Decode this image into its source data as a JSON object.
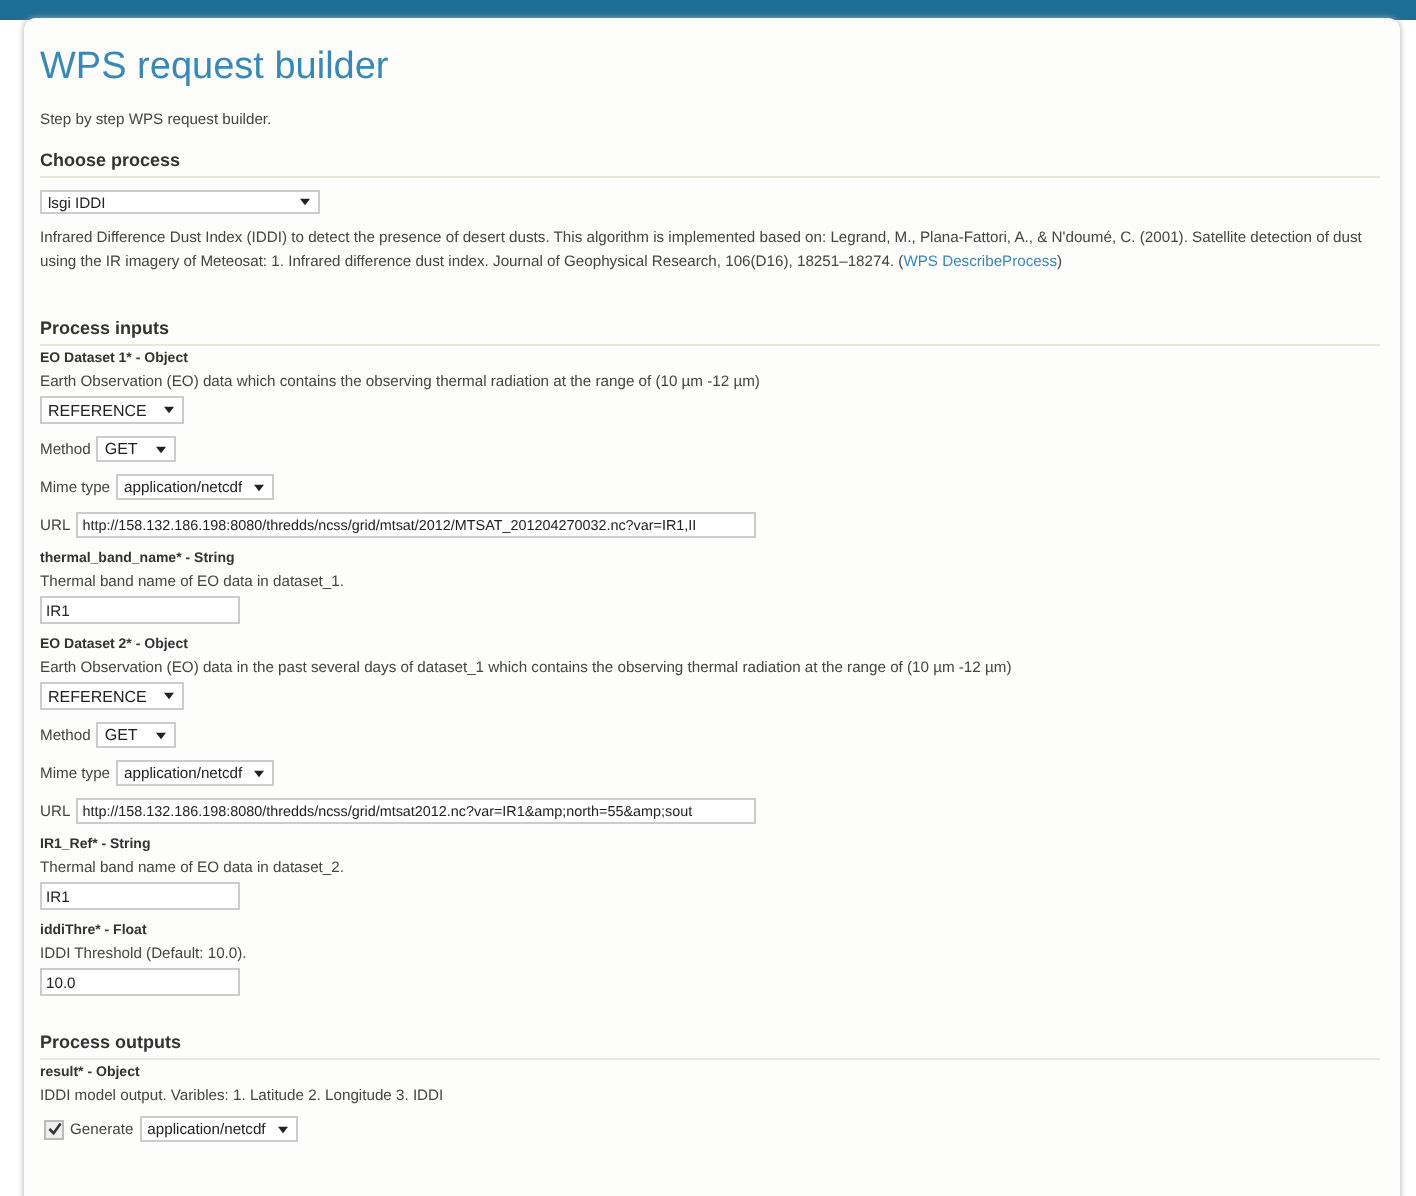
{
  "page": {
    "title": "WPS request builder",
    "subtitle": "Step by step WPS request builder."
  },
  "choose_process": {
    "heading": "Choose process",
    "select": "lsgi IDDI",
    "description": "Infrared Difference Dust Index (IDDI) to detect the presence of desert dusts. This algorithm is implemented based on: Legrand, M., Plana-Fattori, A., & N'doumé, C. (2001). Satellite detection of dust using the IR imagery of Meteosat: 1. Infrared difference dust index. Journal of Geophysical Research, 106(D16), 18251–18274. (",
    "link": "WPS DescribeProcess",
    "description_end": ")"
  },
  "process_inputs": {
    "heading": "Process inputs",
    "inputs": [
      {
        "kind": "complex",
        "name": "EO Dataset 1*",
        "type": " - Object",
        "description": "Earth Observation (EO) data which contains the observing thermal radiation at the range of (10 µm -12 µm)",
        "mode": "REFERENCE",
        "method_label": "Method",
        "method": "GET",
        "mime_label": "Mime type",
        "mime": "application/netcdf",
        "url_label": "URL",
        "url": "http://158.132.186.198:8080/thredds/ncss/grid/mtsat/2012/MTSAT_201204270032.nc?var=IR1,II"
      },
      {
        "kind": "literal",
        "name": "thermal_band_name*",
        "type": " - String",
        "description": "Thermal band name of EO data in dataset_1.",
        "value": "IR1"
      },
      {
        "kind": "complex",
        "name": "EO Dataset 2*",
        "type": " - Object",
        "description": "Earth Observation (EO) data in the past several days of dataset_1 which contains the observing thermal radiation at the range of (10 µm -12 µm)",
        "mode": "REFERENCE",
        "method_label": "Method",
        "method": "GET",
        "mime_label": "Mime type",
        "mime": "application/netcdf",
        "url_label": "URL",
        "url": "http://158.132.186.198:8080/thredds/ncss/grid/mtsat2012.nc?var=IR1&amp;north=55&amp;sout"
      },
      {
        "kind": "literal",
        "name": "IR1_Ref*",
        "type": " - String",
        "description": "Thermal band name of EO data in dataset_2.",
        "value": "IR1"
      },
      {
        "kind": "literal",
        "name": "iddiThre*",
        "type": " - Float",
        "description": "IDDI Threshold (Default: 10.0).",
        "value": "10.0"
      }
    ]
  },
  "process_outputs": {
    "heading": "Process outputs",
    "outputs": [
      {
        "name": "result*",
        "type": " - Object",
        "description": "IDDI model output. Varibles: 1. Latitude 2. Longitude 3. IDDI",
        "generate_label": "Generate",
        "checked": true,
        "mime": "application/netcdf"
      }
    ]
  }
}
